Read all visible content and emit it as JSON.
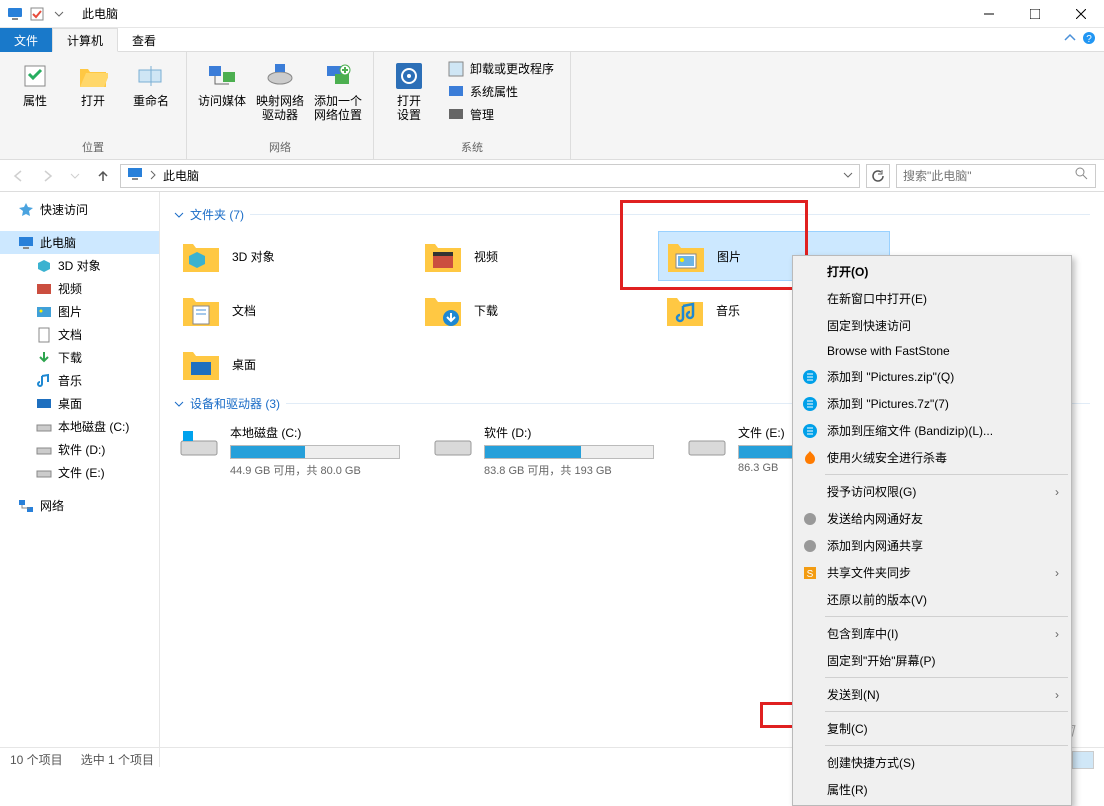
{
  "title": "此电脑",
  "tabs": {
    "file": "文件",
    "computer": "计算机",
    "view": "查看"
  },
  "ribbon": {
    "g1": {
      "label": "位置",
      "b1": "属性",
      "b2": "打开",
      "b3": "重命名"
    },
    "g2": {
      "label": "网络",
      "b1": "访问媒体",
      "b2": "映射网络\n驱动器",
      "b3": "添加一个\n网络位置"
    },
    "g3": {
      "label": "系统",
      "b1": "打开\n设置",
      "i1": "卸载或更改程序",
      "i2": "系统属性",
      "i3": "管理"
    }
  },
  "address": "此电脑",
  "search_placeholder": "搜索\"此电脑\"",
  "sidebar": {
    "quick": "快速访问",
    "pc": "此电脑",
    "d3d": "3D 对象",
    "video": "视频",
    "pictures": "图片",
    "docs": "文档",
    "downloads": "下载",
    "music": "音乐",
    "desktop": "桌面",
    "cdrive": "本地磁盘 (C:)",
    "ddrive": "软件 (D:)",
    "edrive": "文件 (E:)",
    "network": "网络"
  },
  "groups": {
    "folders": "文件夹 (7)",
    "devices": "设备和驱动器 (3)"
  },
  "folders": {
    "d3d": "3D 对象",
    "video": "视频",
    "pictures": "图片",
    "docs": "文档",
    "downloads": "下载",
    "music": "音乐",
    "desktop": "桌面"
  },
  "drives": {
    "c": {
      "name": "本地磁盘 (C:)",
      "text": "44.9 GB 可用，共 80.0 GB",
      "pct": 44
    },
    "d": {
      "name": "软件 (D:)",
      "text": "83.8 GB 可用，共 193 GB",
      "pct": 57
    },
    "e": {
      "name": "文件 (E:)",
      "text": "86.3 GB",
      "pct": 50
    }
  },
  "menu": {
    "open": "打开(O)",
    "new_window": "在新窗口中打开(E)",
    "pin_quick": "固定到快速访问",
    "browse_fs": "Browse with FastStone",
    "add_zip": "添加到 \"Pictures.zip\"(Q)",
    "add_7z": "添加到 \"Pictures.7z\"(7)",
    "add_bandizip": "添加到压缩文件 (Bandizip)(L)...",
    "huorong": "使用火绒安全进行杀毒",
    "access": "授予访问权限(G)",
    "send_friend": "发送给内网通好友",
    "add_share": "添加到内网通共享",
    "sync": "共享文件夹同步",
    "restore": "还原以前的版本(V)",
    "library": "包含到库中(I)",
    "pin_start": "固定到\"开始\"屏幕(P)",
    "send_to": "发送到(N)",
    "copy": "复制(C)",
    "shortcut": "创建快捷方式(S)",
    "properties": "属性(R)"
  },
  "status": {
    "count": "10 个项目",
    "selected": "选中 1 个项目"
  },
  "watermark": "江西龙网"
}
